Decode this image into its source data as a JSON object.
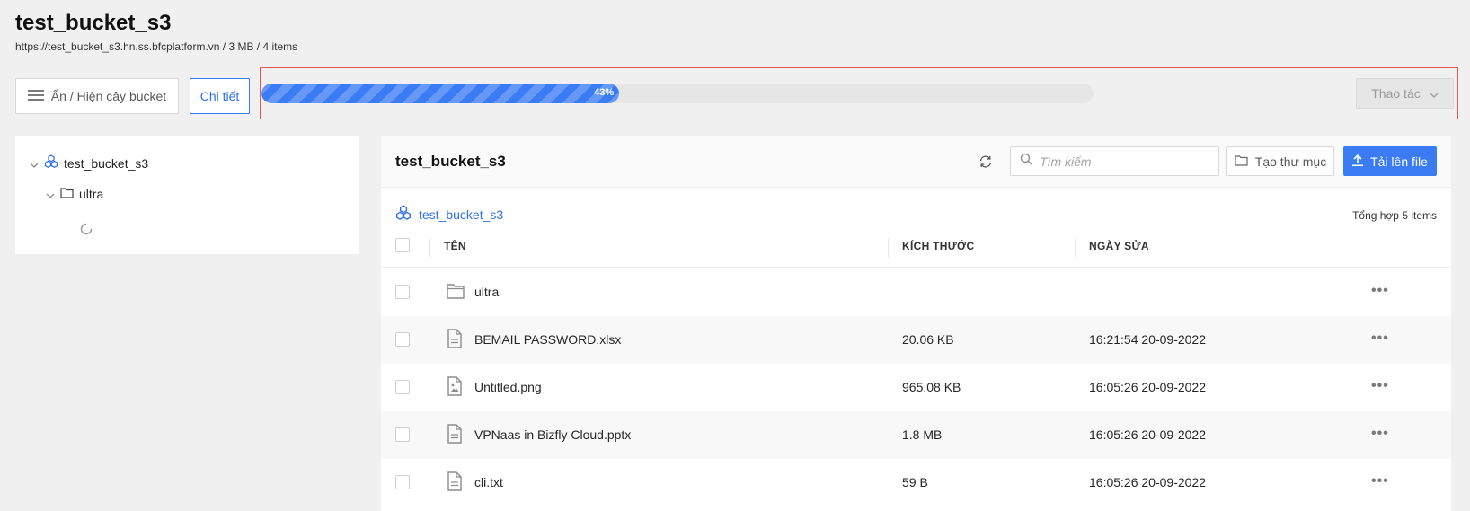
{
  "header": {
    "title": "test_bucket_s3",
    "subtitle": "https://test_bucket_s3.hn.ss.bfcplatform.vn / 3 MB / 4 items"
  },
  "toolbar": {
    "toggle_tree_label": "Ẩn / Hiện cây bucket",
    "detail_label": "Chi tiết",
    "progress_percent": 43,
    "progress_text": "43%",
    "actions_label": "Thao tác"
  },
  "tree": {
    "root_label": "test_bucket_s3",
    "child_label": "ultra"
  },
  "main": {
    "title": "test_bucket_s3",
    "search_placeholder": "Tìm kiếm",
    "new_folder_label": "Tạo thư mục",
    "upload_label": "Tải lên file",
    "breadcrumb": "test_bucket_s3",
    "total_text": "Tổng hợp 5 items",
    "columns": {
      "name": "TÊN",
      "size": "KÍCH THƯỚC",
      "modified": "NGÀY SỬA"
    },
    "rows": [
      {
        "name": "ultra",
        "size": "",
        "modified": "",
        "icon": "folder-icon"
      },
      {
        "name": "BEMAIL PASSWORD.xlsx",
        "size": "20.06 KB",
        "modified": "16:21:54 20-09-2022",
        "icon": "file-icon"
      },
      {
        "name": "Untitled.png",
        "size": "965.08 KB",
        "modified": "16:05:26 20-09-2022",
        "icon": "image-file-icon"
      },
      {
        "name": "VPNaas in Bizfly Cloud.pptx",
        "size": "1.8 MB",
        "modified": "16:05:26 20-09-2022",
        "icon": "file-icon"
      },
      {
        "name": "cli.txt",
        "size": "59 B",
        "modified": "16:05:26 20-09-2022",
        "icon": "file-icon"
      }
    ],
    "more_glyph": "•••"
  },
  "colors": {
    "accent": "#3b7cf5",
    "progress_frame": "#e8574c",
    "background": "#f0f0f0"
  }
}
